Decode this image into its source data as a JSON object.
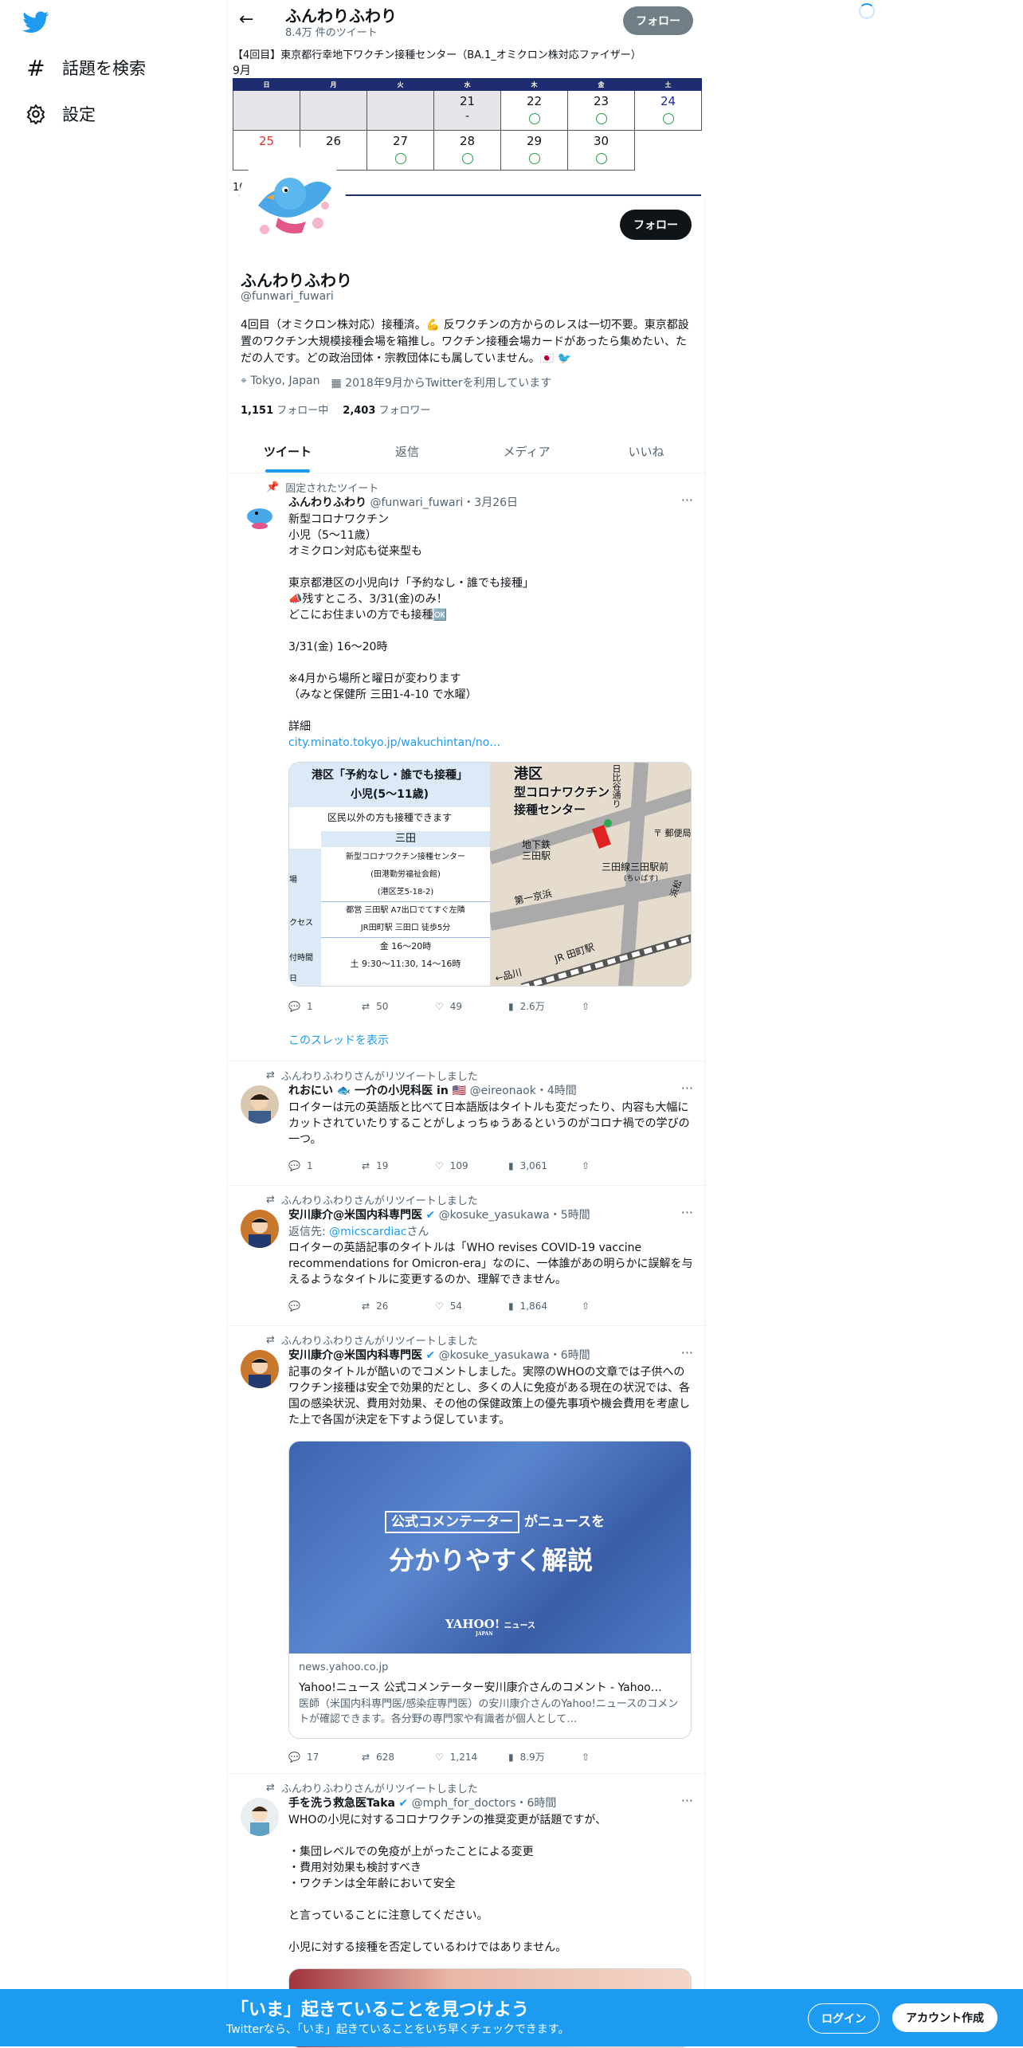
{
  "nav": {
    "explore_label": "話題を検索",
    "settings_label": "設定"
  },
  "header": {
    "name": "ふんわりふわり",
    "tweet_count": "8.4万 件のツイート",
    "follow_label": "フォロー"
  },
  "banner": {
    "title": "【4回目】東京都行幸地下ワクチン接種センター（BA.1_オミクロン株対応ファイザー）",
    "month": "9月",
    "next_month": "10",
    "weekdays": [
      "日",
      "月",
      "火",
      "水",
      "木",
      "金",
      "土"
    ],
    "week1": [
      "",
      "",
      "",
      "21",
      "22",
      "23",
      "24"
    ],
    "week1_dash": "-",
    "week2": [
      "25",
      "26",
      "27",
      "28",
      "29",
      "30",
      ""
    ]
  },
  "profile": {
    "follow_label": "フォロー",
    "name": "ふんわりふわり",
    "handle": "@funwari_fuwari",
    "bio": "4回目（オミクロン株対応）接種済。💪 反ワクチンの方からのレスは一切不要。東京都設置のワクチン大規模接種会場を箱推し。ワクチン接種会場カードがあったら集めたい、ただの人です。どの政治団体・宗教団体にも属していません。🇯🇵 🐦",
    "location": "Tokyo, Japan",
    "joined": "2018年9月からTwitterを利用しています",
    "following_count": "1,151",
    "following_label": "フォロー中",
    "followers_count": "2,403",
    "followers_label": "フォロワー"
  },
  "tabs": [
    "ツイート",
    "返信",
    "メディア",
    "いいね"
  ],
  "tweets": [
    {
      "context": "固定されたツイート",
      "name": "ふんわりふわり",
      "handle": "@funwari_fuwari",
      "time": "・3月26日",
      "text": "新型コロナワクチン\n小児（5〜11歳）\nオミクロン対応も従来型も\n\n東京都港区の小児向け「予約なし・誰でも接種」\n📣残すところ、3/31(金)のみ！\nどこにお住まいの方でも接種🆗\n\n3/31(金) 16〜20時\n\n※4月から場所と曜日が変わります\n（みなと保健所 三田1-4-10 で水曜）\n\n詳細",
      "link": "city.minato.tokyo.jp/wakuchintan/no…",
      "image": {
        "heading": "港区「予約なし・誰でも接種」",
        "subheading": "小児(5〜11歳)",
        "note": "区民以外の方も接種できます",
        "venue_header": "三田",
        "venue": "新型コロナワクチン接種センター",
        "venue2": "(田港勤労福祉会館)",
        "address": "(港区芝5-18-2)",
        "access1": "都営 三田駅 A7出口でてすぐ左隣",
        "access2": "JR田町駅 三田口 徒歩5分",
        "hours1": "金 16〜20時",
        "hours2": "土 9:30〜11:30, 14〜16時",
        "row_labels": [
          "場",
          "クセス",
          "付時間",
          "日"
        ],
        "map_title1": "港区",
        "map_title2": "型コロナワクチン",
        "map_title3": "接種センター",
        "map_road": "日比谷通り",
        "map_station1": "地下鉄",
        "map_station2": "三田駅",
        "map_line": "三田線三田駅前",
        "map_keikyu": "第一京浜",
        "map_jr": "JR 田町駅",
        "map_post": "〒 郵便局",
        "map_shinagawa": "←品川",
        "map_chiibasu": "(ちぃばす)",
        "map_hama": "浜松"
      },
      "replies": "1",
      "retweets": "50",
      "likes": "49",
      "views": "2.6万",
      "thread_label": "このスレッドを表示"
    },
    {
      "context": "ふんわりふわりさんがリツイートしました",
      "name": "れおにい 🐟 一介の小児科医 in 🇺🇸",
      "handle": "@eireonaok",
      "time": "・4時間",
      "text": "ロイターは元の英語版と比べて日本語版はタイトルも変だったり、内容も大幅にカットされていたりすることがしょっちゅうあるというのがコロナ禍での学びの一つ。",
      "replies": "1",
      "retweets": "19",
      "likes": "109",
      "views": "3,061"
    },
    {
      "context": "ふんわりふわりさんがリツイートしました",
      "name": "安川康介@米国内科専門医",
      "handle": "@kosuke_yasukawa",
      "time": "・5時間",
      "reply_to_label": "返信先:",
      "reply_to": "@micscardiac",
      "reply_to_suffix": "さん",
      "text": "ロイターの英語記事のタイトルは「WHO revises COVID-19 vaccine recommendations for Omicron-era」なのに、一体誰があの明らかに誤解を与えるようなタイトルに変更するのか、理解できません。",
      "replies": "",
      "retweets": "26",
      "likes": "54",
      "views": "1,864"
    },
    {
      "context": "ふんわりふわりさんがリツイートしました",
      "name": "安川康介@米国内科専門医",
      "handle": "@kosuke_yasukawa",
      "time": "・6時間",
      "text": "記事のタイトルが酷いのでコメントしました。実際のWHOの文章では子供へのワクチン接種は安全で効果的だとし、多くの人に免疫がある現在の状況では、各国の感染状況、費用対効果、その他の保健政策上の優先事項や機会費用を考慮した上で各国が決定を下すよう促しています。",
      "card": {
        "badge": "公式コメンテーター",
        "badge_suffix": "がニュースを",
        "headline": "分かりやすく解説",
        "brand": "YAHOO!",
        "brand_suffix": "ニュース",
        "brand_sub": "JAPAN",
        "domain": "news.yahoo.co.jp",
        "title": "Yahoo!ニュース 公式コメンテーター安川康介さんのコメント - Yahoo…",
        "desc": "医師（米国内科専門医/感染症専門医）の安川康介さんのYahoo!ニュースのコメントが確認できます。各分野の専門家や有識者が個人として…"
      },
      "replies": "17",
      "retweets": "628",
      "likes": "1,214",
      "views": "8.9万"
    },
    {
      "context": "ふんわりふわりさんがリツイートしました",
      "name": "手を洗う救急医Taka",
      "handle": "@mph_for_doctors",
      "time": "・6時間",
      "text": "WHOの小児に対するコロナワクチンの推奨変更が話題ですが、\n\n・集団レベルでの免疫が上がったことによる変更\n・費用対効果も検討すべき\n・ワクチンは全年齢において安全\n\nと言っていることに注意してください。\n\n小児に対する接種を否定しているわけではありません。"
    }
  ],
  "footer": {
    "headline": "「いま」起きていることを見つけよう",
    "sub": "Twitterなら、「いま」起きていることをいち早くチェックできます。",
    "login": "ログイン",
    "signup": "アカウント作成"
  }
}
